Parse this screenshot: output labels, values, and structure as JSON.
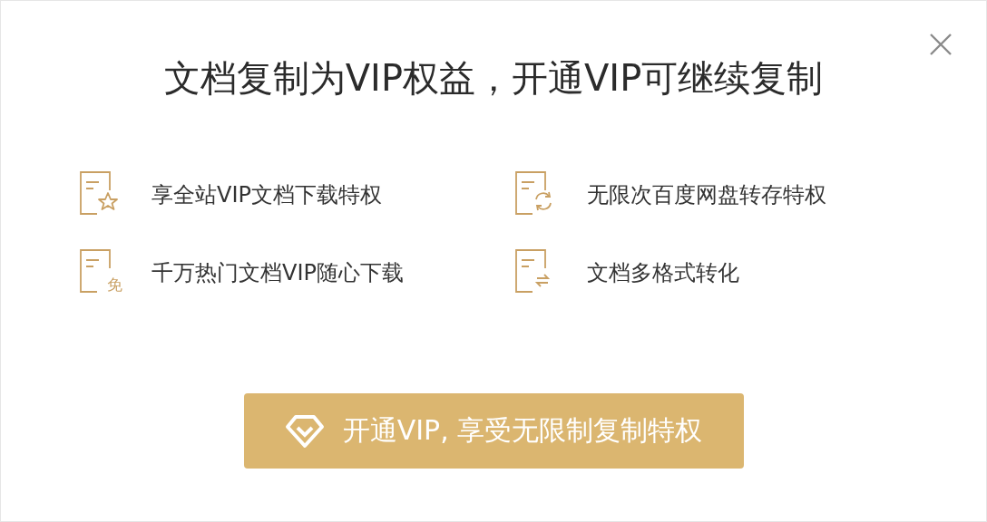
{
  "dialog": {
    "title": "文档复制为VIP权益，开通VIP可继续复制",
    "features": [
      {
        "kind": "star",
        "label": "享全站VIP文档下载特权"
      },
      {
        "kind": "sync",
        "label": "无限次百度网盘转存特权"
      },
      {
        "kind": "free",
        "badge": "免",
        "label": "千万热门文档VIP随心下载"
      },
      {
        "kind": "convert",
        "label": "文档多格式转化"
      }
    ],
    "button": "开通VIP, 享受无限制复制特权"
  }
}
